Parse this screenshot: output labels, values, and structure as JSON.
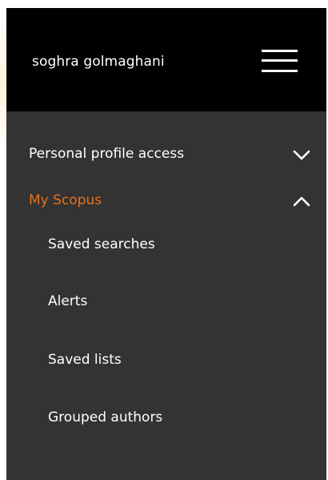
{
  "header": {
    "user_name": "soghra golmaghani",
    "menu_icon": "hamburger-menu-icon"
  },
  "nav": {
    "personal_profile": {
      "label": "Personal profile access",
      "icon": "chevron-down-icon"
    },
    "my_scopus": {
      "label": "My Scopus",
      "icon": "chevron-up-icon",
      "active_color": "#e9711c",
      "items": [
        {
          "label": "Saved searches"
        },
        {
          "label": "Alerts"
        },
        {
          "label": "Saved lists"
        },
        {
          "label": "Grouped authors"
        }
      ]
    }
  },
  "colors": {
    "header_bg": "#000000",
    "panel_bg": "#333333",
    "text": "#ffffff",
    "accent": "#e9711c"
  }
}
